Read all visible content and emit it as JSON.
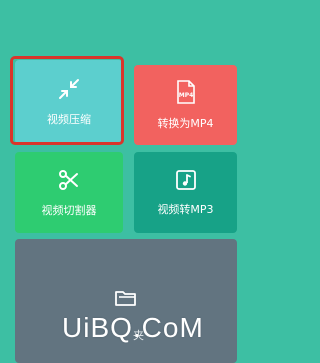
{
  "tiles": [
    {
      "label": "视频压缩",
      "icon": "compress-arrows-icon",
      "color": "#5ccfce",
      "highlighted": true
    },
    {
      "label": "转换为MP4",
      "icon": "mp4-file-icon",
      "color": "#f2625f",
      "icon_text": "MP4"
    },
    {
      "label": "视频切割器",
      "icon": "scissors-icon",
      "color": "#2ecc71"
    },
    {
      "label": "视频转MP3",
      "icon": "music-note-icon",
      "color": "#17a287"
    },
    {
      "label": "",
      "icon": "folder-icon",
      "color": "#627480"
    }
  ],
  "overlay_text": "夹",
  "watermark": "UiBQ.CoM",
  "colors": {
    "background": "#3dbfa3",
    "highlight_border": "#d9352b"
  }
}
